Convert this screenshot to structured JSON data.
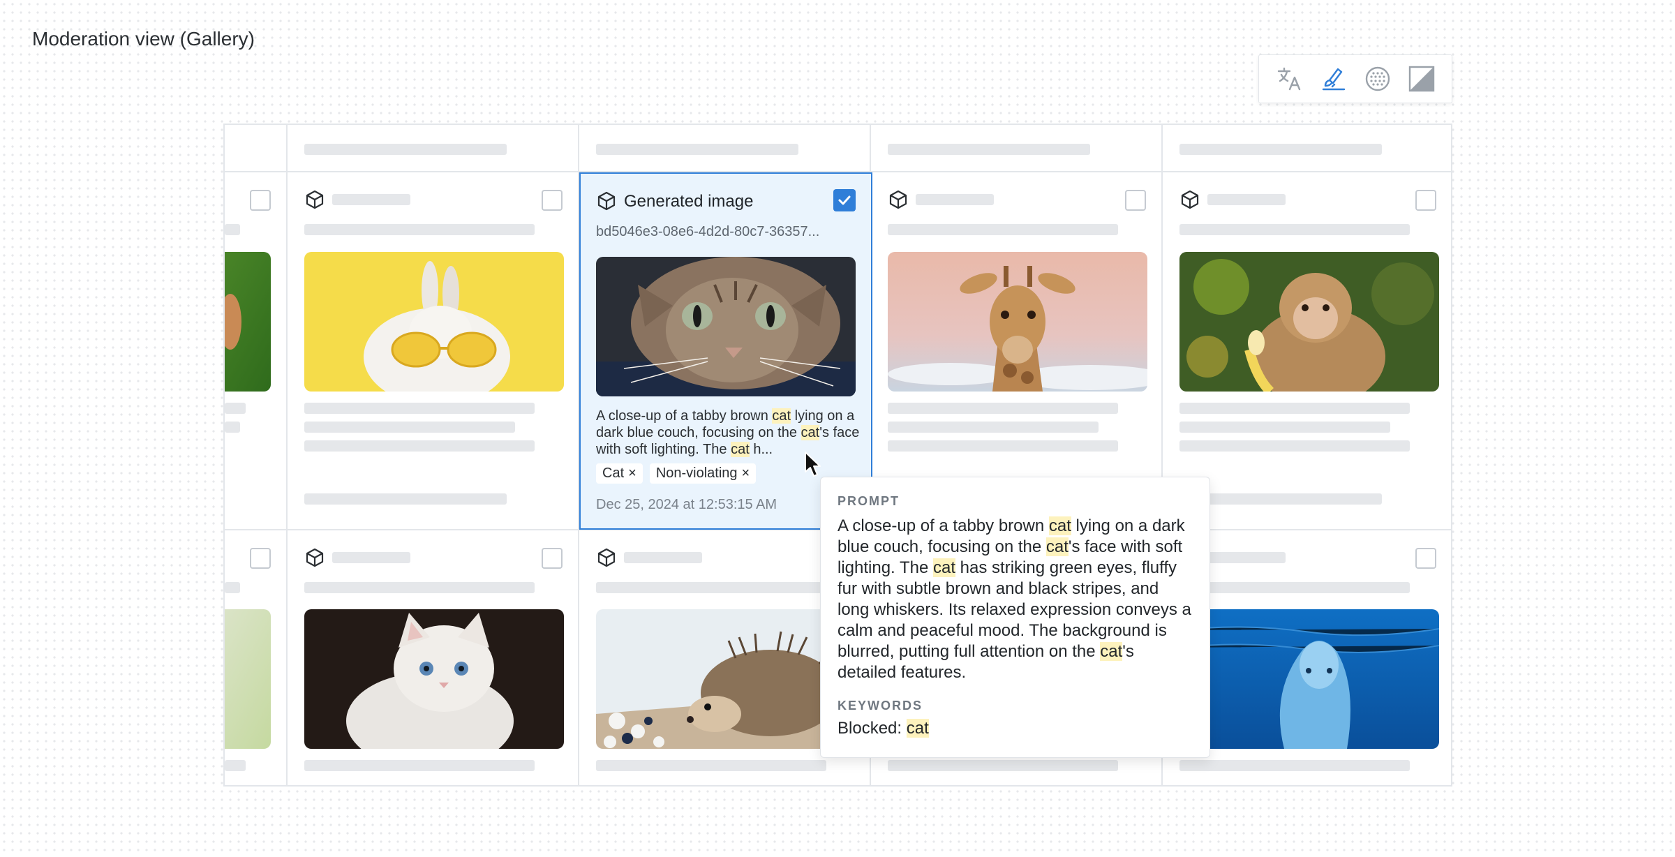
{
  "page": {
    "title": "Moderation view (Gallery)"
  },
  "toolbar": {
    "tools": [
      {
        "icon": "translate-icon",
        "active": false
      },
      {
        "icon": "highlight-brush-icon",
        "active": true
      },
      {
        "icon": "blur-pattern-icon",
        "active": false
      },
      {
        "icon": "contrast-icon",
        "active": false
      }
    ]
  },
  "selected_card": {
    "icon": "cube-icon",
    "title": "Generated image",
    "id": "bd5046e3-08e6-4d2d-80c7-36357...",
    "checked": true,
    "description": {
      "p1": "A close-up of a tabby brown ",
      "k1": "cat",
      "p2": " lying on a dark blue couch, focusing on the ",
      "k2": "cat",
      "p3": "'s face with soft lighting. The ",
      "k3": "cat",
      "p4": " h..."
    },
    "tags": [
      "Cat",
      "Non-violating"
    ],
    "tag_remove_symbol": "×",
    "date": "Dec 25, 2024 at 12:53:15 AM"
  },
  "thumbnails": [
    "rabbit-with-sunglasses",
    "tabby-cat",
    "giraffe",
    "monkey-eating-banana",
    "white-kitten",
    "hedgehog",
    "dolphin"
  ],
  "popover": {
    "prompt_label": "PROMPT",
    "prompt": {
      "p1": "A close-up of a tabby brown ",
      "k1": "cat",
      "p2": " lying on a dark blue couch, focusing on the ",
      "k2": "cat",
      "p3": "'s face with soft lighting. The ",
      "k3": "cat",
      "p4": " has striking green eyes, fluffy fur with subtle brown and black stripes, and long whiskers. Its relaxed expression conveys a calm and peaceful mood. The background is blurred, putting full attention on the ",
      "k4": "cat",
      "p5": "'s detailed features."
    },
    "keywords_label": "KEYWORDS",
    "keywords_prefix": "Blocked: ",
    "keywords_value": "cat"
  },
  "colors": {
    "accent": "#2f7ed8",
    "selected_bg": "#eaf4fd",
    "highlight": "#fdf2bd",
    "placeholder": "#e5e7ea"
  }
}
